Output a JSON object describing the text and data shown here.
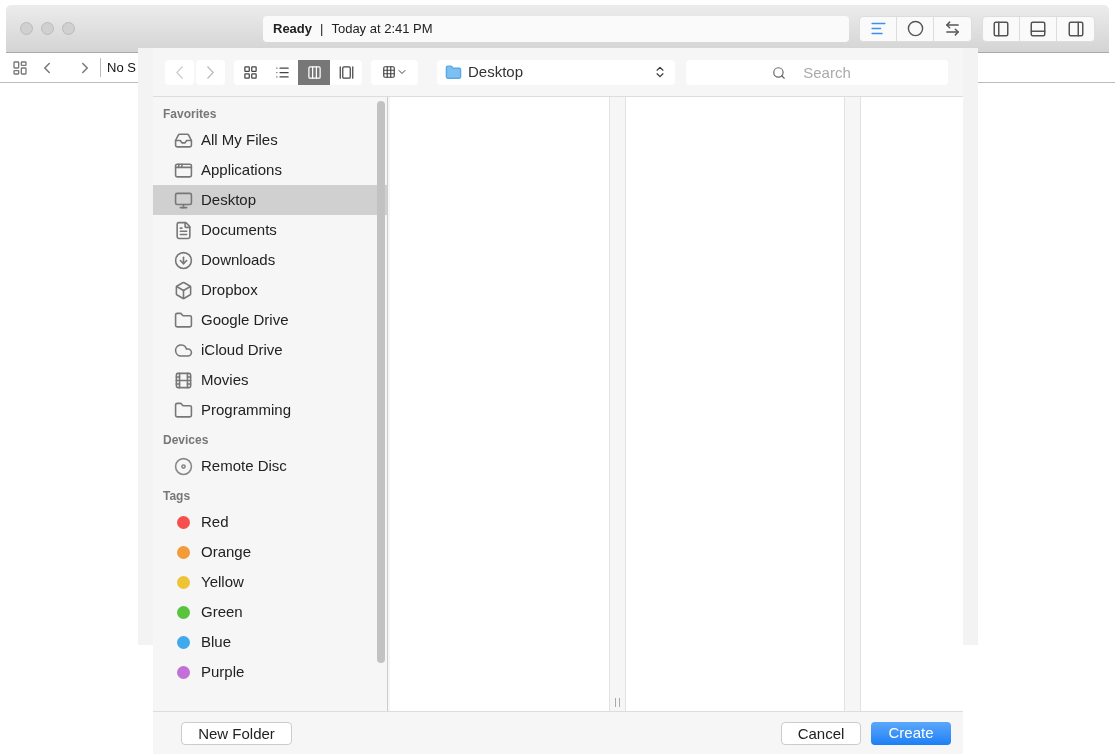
{
  "window": {
    "status": {
      "state": "Ready",
      "separator": "|",
      "time": "Today at 2:41 PM"
    },
    "editor_buttons": [
      {
        "selected": true
      },
      {
        "selected": false
      },
      {
        "selected": false
      }
    ],
    "panel_buttons": [
      {
        "selected": false
      },
      {
        "selected": false
      },
      {
        "selected": false
      }
    ]
  },
  "navigator_bar": {
    "title": "No S"
  },
  "dialog": {
    "view_buttons": [
      {
        "selected": false
      },
      {
        "selected": false
      },
      {
        "selected": true
      },
      {
        "selected": false
      }
    ],
    "location": "Desktop",
    "search": {
      "placeholder": "Search"
    },
    "sidebar": [
      {
        "heading": "Favorites",
        "items": [
          {
            "kind": "place",
            "label": "All My Files",
            "selected": false
          },
          {
            "kind": "place",
            "label": "Applications",
            "selected": false
          },
          {
            "kind": "place",
            "label": "Desktop",
            "selected": true
          },
          {
            "kind": "place",
            "label": "Documents",
            "selected": false
          },
          {
            "kind": "place",
            "label": "Downloads",
            "selected": false
          },
          {
            "kind": "place",
            "label": "Dropbox",
            "selected": false
          },
          {
            "kind": "place",
            "label": "Google Drive",
            "selected": false
          },
          {
            "kind": "place",
            "label": "iCloud Drive",
            "selected": false
          },
          {
            "kind": "place",
            "label": "Movies",
            "selected": false
          },
          {
            "kind": "place",
            "label": "Programming",
            "selected": false
          }
        ]
      },
      {
        "heading": "Devices",
        "items": [
          {
            "kind": "disc",
            "label": "Remote Disc",
            "selected": false
          }
        ]
      },
      {
        "heading": "Tags",
        "items": [
          {
            "kind": "tag",
            "label": "Red",
            "color": "#f74f4e",
            "selected": false
          },
          {
            "kind": "tag",
            "label": "Orange",
            "color": "#f29b38",
            "selected": false
          },
          {
            "kind": "tag",
            "label": "Yellow",
            "color": "#eec436",
            "selected": false
          },
          {
            "kind": "tag",
            "label": "Green",
            "color": "#5ac33c",
            "selected": false
          },
          {
            "kind": "tag",
            "label": "Blue",
            "color": "#3ea9ec",
            "selected": false
          },
          {
            "kind": "tag",
            "label": "Purple",
            "color": "#c36fd8",
            "selected": false
          }
        ]
      }
    ],
    "new_folder": "New Folder",
    "buttons": [
      {
        "label": "Cancel",
        "kind": "normal"
      },
      {
        "label": "Create",
        "kind": "default"
      }
    ]
  }
}
